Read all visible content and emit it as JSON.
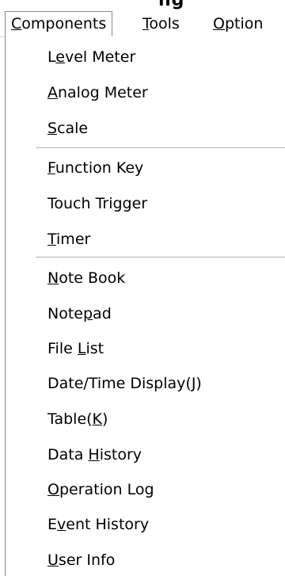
{
  "menubar": {
    "items": [
      {
        "pre": "",
        "mn": "C",
        "post": "omponents"
      },
      {
        "pre": "",
        "mn": "T",
        "post": "ools"
      },
      {
        "pre": "",
        "mn": "O",
        "post": "ption"
      }
    ]
  },
  "components_menu": {
    "groups": [
      [
        {
          "pre": "L",
          "mn": "e",
          "post": "vel Meter"
        },
        {
          "pre": "",
          "mn": "A",
          "post": "nalog Meter"
        },
        {
          "pre": "",
          "mn": "S",
          "post": "cale"
        }
      ],
      [
        {
          "pre": "",
          "mn": "F",
          "post": "unction Key"
        },
        {
          "pre": "Touch Tri",
          "mn": "g",
          "post": "ger"
        },
        {
          "pre": "",
          "mn": "T",
          "post": "imer"
        }
      ],
      [
        {
          "pre": "",
          "mn": "N",
          "post": "ote Book"
        },
        {
          "pre": "Note",
          "mn": "p",
          "post": "ad"
        },
        {
          "pre": "File ",
          "mn": "L",
          "post": "ist"
        },
        {
          "pre": "Date/Time Display(",
          "mn": "J",
          "post": ")"
        },
        {
          "pre": "Table(",
          "mn": "K",
          "post": ")"
        },
        {
          "pre": "Data ",
          "mn": "H",
          "post": "istory"
        },
        {
          "pre": "",
          "mn": "O",
          "post": "peration Log"
        },
        {
          "pre": "E",
          "mn": "v",
          "post": "ent History"
        },
        {
          "pre": "",
          "mn": "U",
          "post": "ser Info"
        }
      ]
    ]
  }
}
